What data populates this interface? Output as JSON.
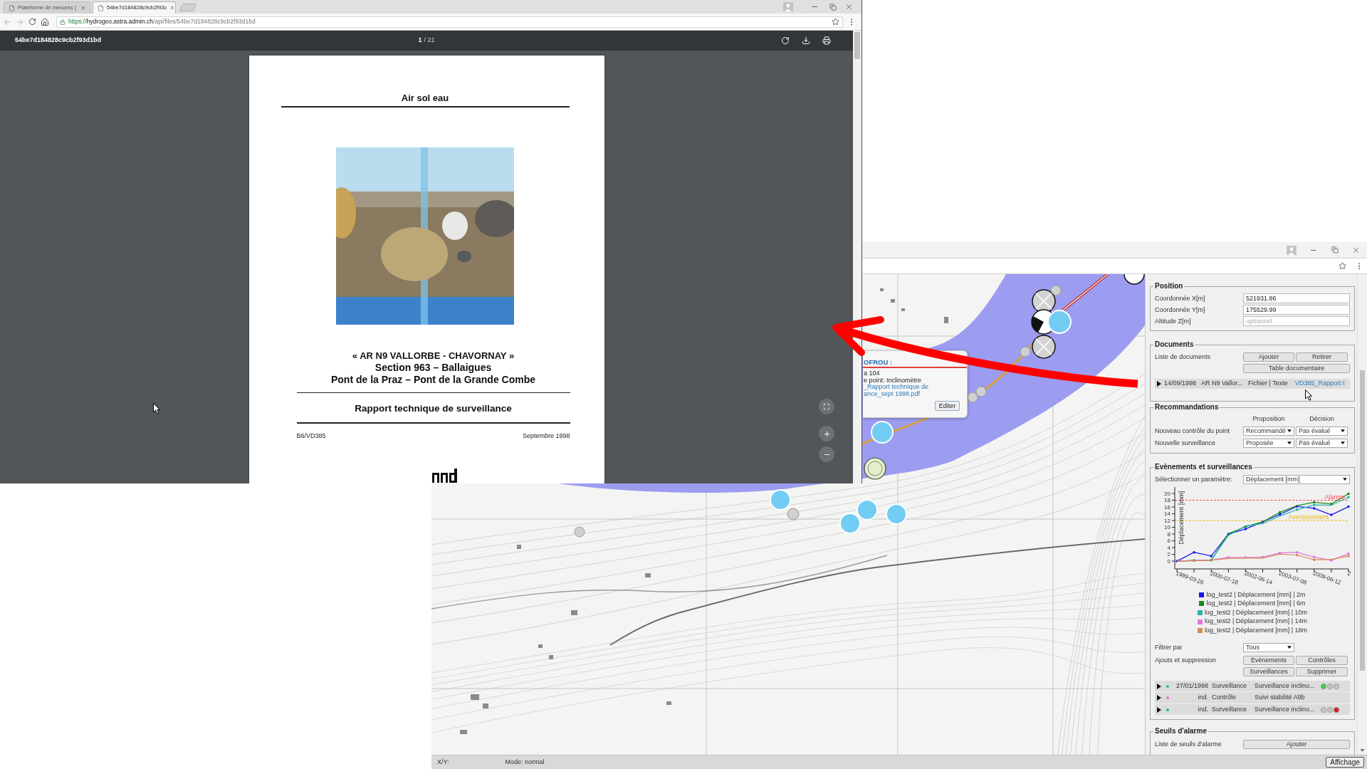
{
  "pdf_window": {
    "tabs": [
      {
        "title": "Plateforme de mesures (",
        "selected": false
      },
      {
        "title": "54be7d184828c9cb2f93c",
        "selected": true
      }
    ],
    "url": {
      "scheme": "https://",
      "host": "hydrogeo.astra.admin.ch",
      "path": "/api/files/54be7d184828c9cb2f93d1bd"
    },
    "toolbar": {
      "file_name": "54be7d184828c9cb2f93d1bd",
      "page": "1",
      "page_count": "/ 21"
    },
    "document": {
      "header": "Air sol eau",
      "title_lines": [
        "« AR N9 VALLORBE - CHAVORNAY »",
        "Section 963 – Ballaigues",
        "Pont de la Praz – Pont de la Grande Combe"
      ],
      "subtitle": "Rapport technique de surveillance",
      "reference": "B6/VD385",
      "date": "Septembre 1998"
    }
  },
  "map_window": {
    "popup": {
      "title": "OFROU :",
      "lines": [
        "a 104",
        "e point: Inclinomètre"
      ],
      "link_lines": [
        "_Rapport technique de",
        "ance_sept 1998.pdf"
      ],
      "button": "Editer"
    },
    "panel": {
      "position": {
        "title": "Position",
        "fields": [
          {
            "label": "Coordonnée X[m]",
            "value": "521931.86"
          },
          {
            "label": "Coordonnée Y[m]",
            "value": "175529.99"
          },
          {
            "label": "Altitude Z[m]",
            "placeholder": "optionnel"
          }
        ]
      },
      "documents": {
        "title": "Documents",
        "label": "Liste de documents",
        "buttons": [
          "Ajouter",
          "Retirer"
        ],
        "table_button": "Table documentaire",
        "rows": [
          {
            "expanded": false,
            "date": "14/09/1998",
            "name": "AR N9 Vallor...",
            "type": "Fichier | Texte",
            "file": "VD385_Rapport t"
          }
        ]
      },
      "recommendations": {
        "title": "Recommandations",
        "columns": [
          "Proposition",
          "Décision"
        ],
        "rows": [
          {
            "label": "Nouveau contrôle du point",
            "proposal": "Recommandé",
            "decision": "Pas évalué"
          },
          {
            "label": "Nouvelle surveillance",
            "proposal": "Proposée",
            "decision": "Pas évalué"
          }
        ]
      },
      "events": {
        "title": "Evènements et surveillances",
        "parameter_label": "Sélectionner un paramètre:",
        "parameter": "Déplacement [mm]",
        "chart_data": {
          "type": "line",
          "ylabel": "Déplacement [mm]",
          "categories": [
            "1999-03-26",
            null,
            "2000-07-18",
            null,
            "2002-06-14",
            null,
            "2003-07-08",
            null,
            "2009-06-12",
            null,
            "2"
          ],
          "series": [
            {
              "name": "log_test2 | Déplacement [mm] | 2m",
              "color": "#1515f0",
              "values": [
                0,
                2.6,
                1.5,
                8.0,
                9.5,
                11.6,
                13.8,
                16.2,
                15.6,
                13.7,
                16.1
              ]
            },
            {
              "name": "log_test2 | Déplacement [mm] | 6m",
              "color": "#1a8a1a",
              "values": [
                0,
                0.2,
                0.3,
                8.1,
                10.2,
                11.6,
                14.4,
                16.4,
                17.4,
                16.9,
                19.9
              ]
            },
            {
              "name": "log_test2 | Déplacement [mm] | 10m",
              "color": "#2bb5a8",
              "values": [
                0,
                0.2,
                0.3,
                7.6,
                10.4,
                11.1,
                13.3,
                15.2,
                16.6,
                16.5,
                18.9
              ]
            },
            {
              "name": "log_test2 | Déplacement [mm] | 14m",
              "color": "#e276e2",
              "values": [
                0,
                0.2,
                0.3,
                1.1,
                1.1,
                1.2,
                2.4,
                2.6,
                1.2,
                0.2,
                2.2
              ]
            },
            {
              "name": "log_test2 | Déplacement [mm] | 18m",
              "color": "#d98b4c",
              "values": [
                0,
                0.1,
                0.3,
                0.8,
                0.9,
                0.9,
                2.1,
                1.8,
                0.4,
                0.5,
                1.5
              ]
            }
          ],
          "ylim": [
            -2.3,
            21.9
          ],
          "yticks": [
            0,
            2,
            4,
            6,
            8,
            10,
            12,
            14,
            16,
            18,
            20
          ],
          "ref_lines": [
            {
              "axis": "y",
              "value": 18,
              "label": "Alarme",
              "color": "#ff4a4a"
            },
            {
              "axis": "y",
              "value": 12,
              "label": "Avertissement",
              "color": "#f2b705"
            }
          ]
        },
        "filter_label": "Filtrer par",
        "filter": "Tous",
        "actions_label": "Ajouts et suppression",
        "buttons": [
          "Evènements",
          "Contrôles",
          "Surveillances",
          "Supprimer"
        ],
        "rows": [
          {
            "expanded": false,
            "color": "#2bb5a8",
            "date": "27/01/1998",
            "type": "Surveillance",
            "description": "Surveillance inclino...",
            "lights": [
              {
                "color": "#3fcf3f"
              },
              {
                "color": "#c4c4c4"
              },
              {
                "color": "#c4c4c4"
              }
            ]
          },
          {
            "expanded": false,
            "color": "#e276e2",
            "date": "ind.",
            "type": "Contrôle",
            "description": "Suivi stabilité A9b"
          },
          {
            "expanded": false,
            "color": "#2bb5a8",
            "date": "ind.",
            "type": "Surveillance",
            "description": "Surveillance inclino...",
            "lights": [
              {
                "color": "#c4c4c4"
              },
              {
                "color": "#c4c4c4"
              },
              {
                "color": "#e02020"
              }
            ]
          }
        ]
      },
      "alarm_thresholds": {
        "title": "Seuils d'alarme",
        "label": "Liste de seuils d'alarme",
        "button": "Ajouter"
      }
    },
    "status_bar": {
      "coordinates": "X/Y:",
      "mode": "Mode: normal",
      "button": "Affichage"
    }
  }
}
